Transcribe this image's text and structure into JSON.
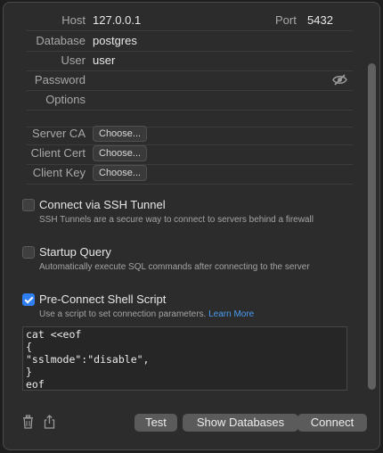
{
  "connection": {
    "host_label": "Host",
    "host_value": "127.0.0.1",
    "port_label": "Port",
    "port_value": "5432",
    "database_label": "Database",
    "database_value": "postgres",
    "user_label": "User",
    "user_value": "user",
    "password_label": "Password",
    "password_value": "",
    "options_label": "Options",
    "options_value": ""
  },
  "certs": {
    "server_ca_label": "Server CA",
    "client_cert_label": "Client Cert",
    "client_key_label": "Client Key",
    "choose_label": "Choose..."
  },
  "ssh": {
    "title": "Connect via SSH Tunnel",
    "desc": "SSH Tunnels are a secure way to connect to servers behind a firewall",
    "checked": false
  },
  "startup": {
    "title": "Startup Query",
    "desc": "Automatically execute SQL commands after connecting to the server",
    "checked": false
  },
  "preconnect": {
    "title": "Pre-Connect Shell Script",
    "desc": "Use a script to set connection parameters.",
    "link": "Learn More",
    "checked": true,
    "script": "cat <<eof\n{\n\"sslmode\":\"disable\",\n}\neof"
  },
  "footer": {
    "test_label": "Test",
    "show_db_label": "Show Databases",
    "connect_label": "Connect"
  },
  "icons": {
    "eye": "eye-slash-icon",
    "trash": "trash-icon",
    "share": "share-icon"
  }
}
